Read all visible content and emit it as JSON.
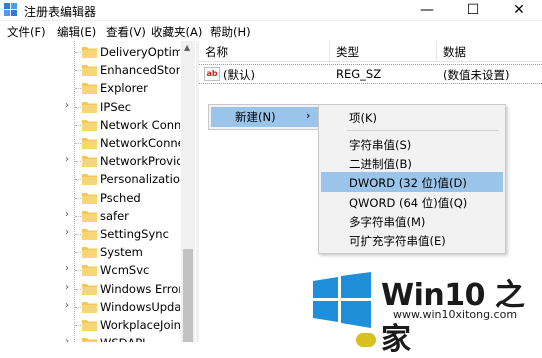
{
  "window": {
    "title": "注册表编辑器",
    "controls": {
      "minimize": "—",
      "maximize": "☐",
      "close": "✕"
    }
  },
  "menubar": {
    "items": [
      "文件(F)",
      "编辑(E)",
      "查看(V)",
      "收藏夹(A)",
      "帮助(H)"
    ]
  },
  "tree": {
    "items": [
      {
        "label": "DeliveryOptimiz",
        "expandable": false
      },
      {
        "label": "EnhancedStorag",
        "expandable": false
      },
      {
        "label": "Explorer",
        "expandable": false
      },
      {
        "label": "IPSec",
        "expandable": true
      },
      {
        "label": "Network Conne",
        "expandable": false
      },
      {
        "label": "NetworkConne",
        "expandable": false
      },
      {
        "label": "NetworkProvide",
        "expandable": true
      },
      {
        "label": "Personalization",
        "expandable": false
      },
      {
        "label": "Psched",
        "expandable": false
      },
      {
        "label": "safer",
        "expandable": true
      },
      {
        "label": "SettingSync",
        "expandable": true
      },
      {
        "label": "System",
        "expandable": false
      },
      {
        "label": "WcmSvc",
        "expandable": true
      },
      {
        "label": "Windows Error",
        "expandable": true
      },
      {
        "label": "WindowsUpdat",
        "expandable": true
      },
      {
        "label": "WorkplaceJoin",
        "expandable": false
      },
      {
        "label": "WSDAPI",
        "expandable": true
      }
    ],
    "folder_color": "#f3c85a"
  },
  "values": {
    "columns": [
      "名称",
      "类型",
      "数据"
    ],
    "rows": [
      {
        "icon": "ab",
        "name": "(默认)",
        "type": "REG_SZ",
        "data": "(数值未设置)"
      }
    ]
  },
  "context_menu": {
    "label": "新建(N)",
    "arrow": "›"
  },
  "submenu": {
    "items": [
      {
        "label": "项(K)"
      },
      {
        "label": "字符串值(S)"
      },
      {
        "label": "二进制值(B)"
      },
      {
        "label": "DWORD (32 位)值(D)",
        "highlighted": true
      },
      {
        "label": "QWORD (64 位)值(Q)"
      },
      {
        "label": "多字符串值(M)"
      },
      {
        "label": "可扩充字符串值(E)"
      }
    ],
    "highlight_color": "#9ac4ea"
  },
  "watermark": {
    "brand": "Win10 之家",
    "url": "www.win10xitong.com",
    "logo_color": "#1e8fd8"
  }
}
